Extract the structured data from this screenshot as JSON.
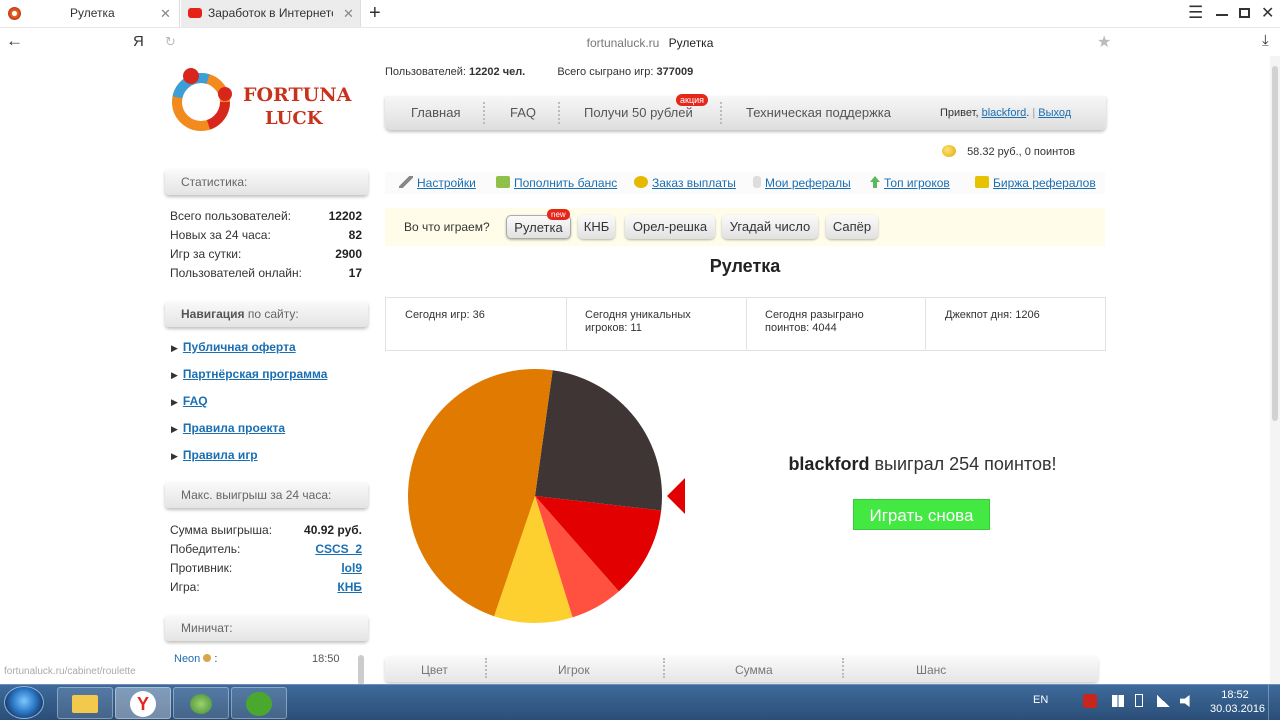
{
  "browser": {
    "tabs": [
      {
        "label": "Рулетка"
      },
      {
        "label": "Заработок в Интернете для"
      }
    ],
    "new_tab_icon": "+",
    "yandex_letter": "Я",
    "address": {
      "domain": "fortunaluck.ru",
      "title": "Рулетка"
    },
    "status_url": "fortunaluck.ru/cabinet/roulette"
  },
  "logo": {
    "line1": "FORTUNA",
    "line2": "LUCK"
  },
  "top_info": {
    "users_label": "Пользователей:",
    "users_value": "12202 чел.",
    "games_label": "Всего сыграно игр:",
    "games_value": "377009"
  },
  "main_menu": {
    "items": [
      "Главная",
      "FAQ",
      "Получи 50 рублей",
      "Техническая поддержка"
    ],
    "promo_badge": "акция",
    "greeting": "Привет,",
    "username": "blackford",
    "separator": "|",
    "logout": "Выход"
  },
  "balance": "58.32 руб., 0 поинтов",
  "sub_menu": [
    "Настройки",
    "Пополнить баланс",
    "Заказ выплаты",
    "Мои рефералы",
    "Топ игроков",
    "Биржа рефералов"
  ],
  "games_bar": {
    "label": "Во что играем?",
    "games": [
      "Рулетка",
      "КНБ",
      "Орел-решка",
      "Угадай число",
      "Сапёр"
    ],
    "new_badge": "new"
  },
  "section_title": "Рулетка",
  "today_stats": [
    {
      "line1": "Сегодня игр: 36",
      "line2": ""
    },
    {
      "line1": "Сегодня уникальных",
      "line2": "игроков: 11"
    },
    {
      "line1": "Сегодня разыграно",
      "line2": "поинтов: 4044"
    },
    {
      "line1": "Джекпот дня: 1206",
      "line2": ""
    }
  ],
  "result": {
    "winner": "blackford",
    "text": "выиграл 254 поинтов!",
    "play_again": "Играть снова"
  },
  "wheel": {
    "slices": [
      {
        "fraction": 0.246,
        "color": "#3f3535"
      },
      {
        "fraction": 0.117,
        "color": "#e30000"
      },
      {
        "fraction": 0.067,
        "color": "#ff5040"
      },
      {
        "fraction": 0.1,
        "color": "#fed02f"
      },
      {
        "fraction": 0.47,
        "color": "#e07a00"
      }
    ],
    "pointer_color": "#e30000"
  },
  "table_headers": [
    "Цвет",
    "Игрок",
    "Сумма",
    "Шанс"
  ],
  "sidebar": {
    "stats_title": "Статистика:",
    "stats": [
      {
        "label": "Всего пользователей:",
        "value": "12202"
      },
      {
        "label": "Новых за 24 часа:",
        "value": "82"
      },
      {
        "label": "Игр за сутки:",
        "value": "2900"
      },
      {
        "label": "Пользователей онлайн:",
        "value": "17"
      }
    ],
    "nav_title_bold": "Навигация",
    "nav_title_rest": "по сайту:",
    "nav_links": [
      "Публичная оферта",
      "Партнёрская программа",
      "FAQ",
      "Правила проекта",
      "Правила игр"
    ],
    "maxwin_title": "Макс. выигрыш за 24 часа:",
    "maxwin": [
      {
        "label": "Сумма выигрыша:",
        "value": "40.92 руб.",
        "link": false
      },
      {
        "label": "Победитель:",
        "value": "CSCS_2",
        "link": true
      },
      {
        "label": "Противник:",
        "value": "lol9",
        "link": true
      },
      {
        "label": "Игра:",
        "value": "КНБ",
        "link": true
      }
    ],
    "chat_title": "Миничат:",
    "chat": {
      "user": "Neon",
      "sep": ":",
      "time": "18:50"
    }
  },
  "taskbar": {
    "lang": "EN",
    "time": "18:52",
    "date": "30.03.2016"
  },
  "colors": {
    "accent_green": "#43e843",
    "link": "#1a6fb3"
  }
}
